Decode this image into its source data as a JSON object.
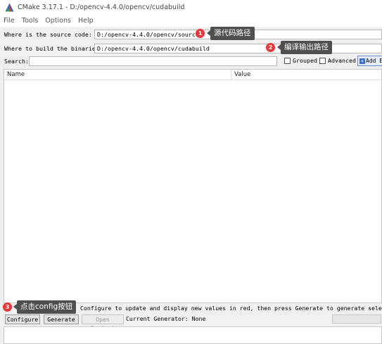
{
  "window": {
    "title": "CMake 3.17.1 - D:/opencv-4.4.0/opencv/cudabuild"
  },
  "menu": [
    "File",
    "Tools",
    "Options",
    "Help"
  ],
  "source": {
    "label": "Where is the source code:",
    "value": "D:/opencv-4.4.0/opencv/sources"
  },
  "build": {
    "label": "Where to build the binaries:",
    "value": "D:/opencv-4.4.0/opencv/cudabuild"
  },
  "search": {
    "label": "Search:",
    "value": ""
  },
  "options": {
    "grouped": {
      "label": "Grouped",
      "checked": false
    },
    "advanced": {
      "label": "Advanced",
      "checked": false
    },
    "add_entry": "Add E"
  },
  "table": {
    "columns": [
      "Name",
      "Value"
    ]
  },
  "status": {
    "text": "Configure to update and display new values in red, then press Generate to generate selected buil"
  },
  "buttons": {
    "configure": "Configure",
    "generate": "Generate",
    "open_project": "Open Project"
  },
  "generator": "Current Generator: None",
  "annotations": [
    {
      "number": "1",
      "text": "源代码路径"
    },
    {
      "number": "2",
      "text": "编译输出路径"
    },
    {
      "number": "3",
      "text": "点击config按钮"
    }
  ],
  "colors": {
    "badge": "#e8373a",
    "callout": "#4f4f4f",
    "window_bg": "#f0f0f0"
  }
}
